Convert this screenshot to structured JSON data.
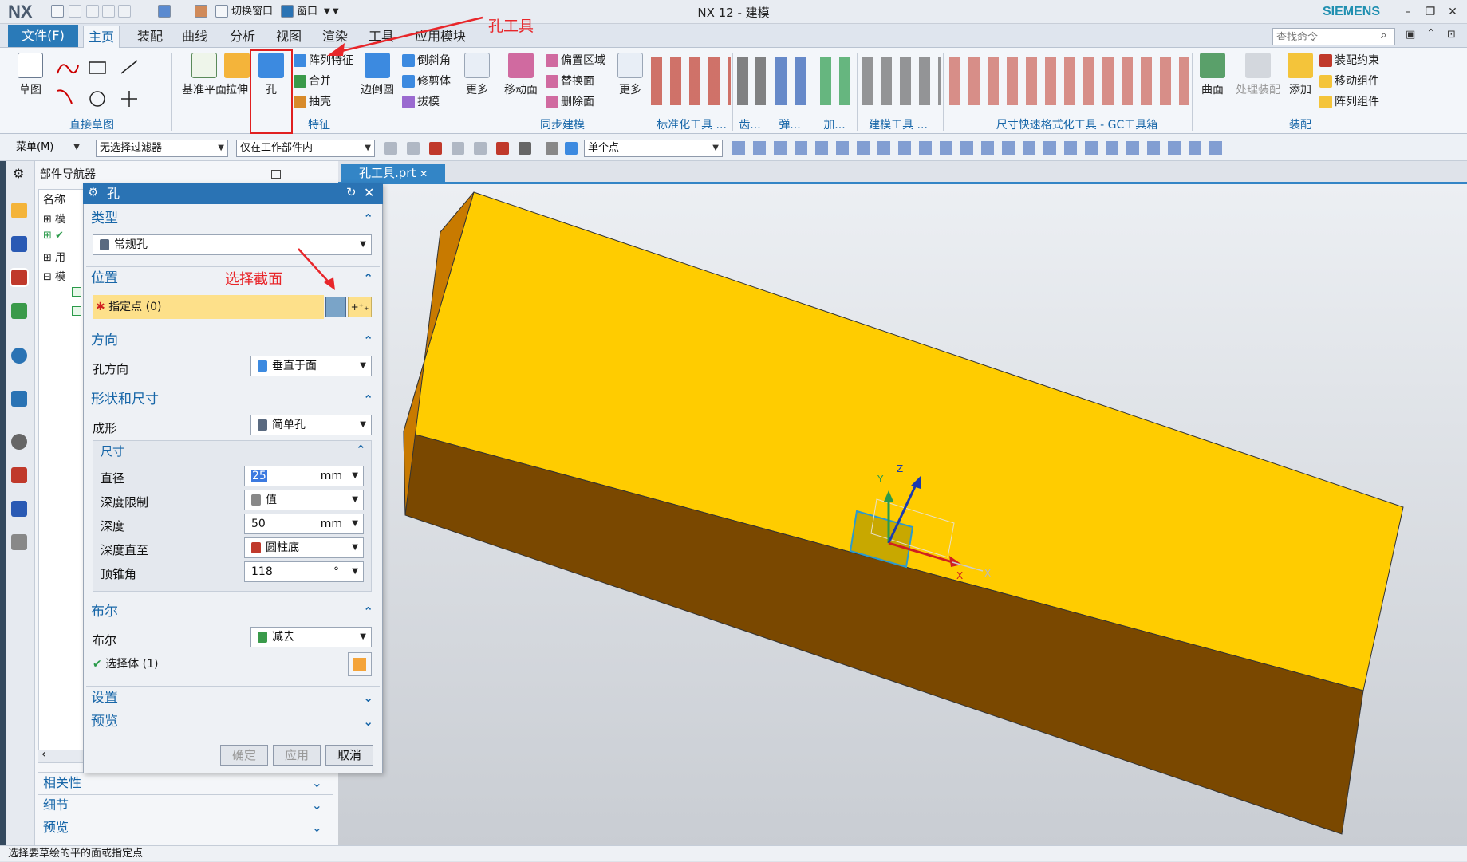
{
  "app": {
    "logo": "NX",
    "window_title": "NX 12 - 建模",
    "brand": "SIEMENS"
  },
  "quick_access": {
    "switch_window": "切换窗口",
    "window_menu": "窗口"
  },
  "menu": {
    "file_label": "文件(F)",
    "tabs": [
      "主页",
      "装配",
      "曲线",
      "分析",
      "视图",
      "渲染",
      "工具",
      "应用模块"
    ],
    "active": "主页"
  },
  "search": {
    "placeholder": "查找命令"
  },
  "ribbon": {
    "groups": [
      {
        "label": "直接草图"
      },
      {
        "label": "特征"
      },
      {
        "label": "同步建模"
      },
      {
        "label": "标准化工具 ..."
      },
      {
        "label": "齿..."
      },
      {
        "label": "弹..."
      },
      {
        "label": "加..."
      },
      {
        "label": "建模工具 ..."
      },
      {
        "label": "尺寸快速格式化工具 - GC工具箱"
      },
      {
        "label": "装配"
      }
    ],
    "sketch": "草图",
    "datum_plane": "基准平面",
    "extrude": "拉伸",
    "hole": "孔",
    "pattern_feature": "阵列特征",
    "combine": "合并",
    "shell": "抽壳",
    "edge_blend": "边倒圆",
    "chamfer": "倒斜角",
    "trim_body": "修剪体",
    "draft": "拔模",
    "more1": "更多",
    "move_face": "移动面",
    "offset_region": "偏置区域",
    "replace_face": "替换面",
    "delete_face": "删除面",
    "more2": "更多",
    "surface": "曲面",
    "process_assembly": "处理装配",
    "add": "添加",
    "assembly_constraint": "装配约束",
    "move_component": "移动组件",
    "pattern_component": "阵列组件"
  },
  "toolbar2": {
    "menu": "菜单(M)",
    "filter": "无选择过滤器",
    "scope": "仅在工作部件内",
    "snap": "单个点"
  },
  "navigator": {
    "title": "部件导航器",
    "column": "名称",
    "items": [
      "模",
      "",
      "用",
      "模"
    ],
    "sections": [
      "相关性",
      "细节",
      "预览"
    ]
  },
  "file_tab": "孔工具.prt",
  "annotations": {
    "hole_tool": "孔工具",
    "select_section": "选择截面"
  },
  "dialog": {
    "title": "孔",
    "type_section": "类型",
    "type_value": "常规孔",
    "position_section": "位置",
    "specify_point": "指定点 (0)",
    "direction_section": "方向",
    "hole_direction_label": "孔方向",
    "hole_direction_value": "垂直于面",
    "shape_section": "形状和尺寸",
    "form_label": "成形",
    "form_value": "简单孔",
    "dims_section": "尺寸",
    "diameter_label": "直径",
    "diameter_value": "25",
    "diameter_unit": "mm",
    "depth_limit_label": "深度限制",
    "depth_limit_value": "值",
    "depth_label": "深度",
    "depth_value": "50",
    "depth_unit": "mm",
    "depth_to_label": "深度直至",
    "depth_to_value": "圆柱底",
    "tip_angle_label": "顶锥角",
    "tip_angle_value": "118",
    "tip_angle_unit": "°",
    "boolean_section": "布尔",
    "boolean_label": "布尔",
    "boolean_value": "减去",
    "select_body": "选择体 (1)",
    "settings_section": "设置",
    "preview_section": "预览",
    "ok": "确定",
    "apply": "应用",
    "cancel": "取消"
  },
  "triad_labels": {
    "x": "X",
    "y": "Y",
    "z": "Z"
  },
  "status": "选择要草绘的平的面或指定点",
  "colors": {
    "accent": "#2a73b4",
    "block_top": "#ffcc00",
    "block_side": "#7a4800",
    "block_end": "#c87a00",
    "annotation": "#e8262a"
  }
}
